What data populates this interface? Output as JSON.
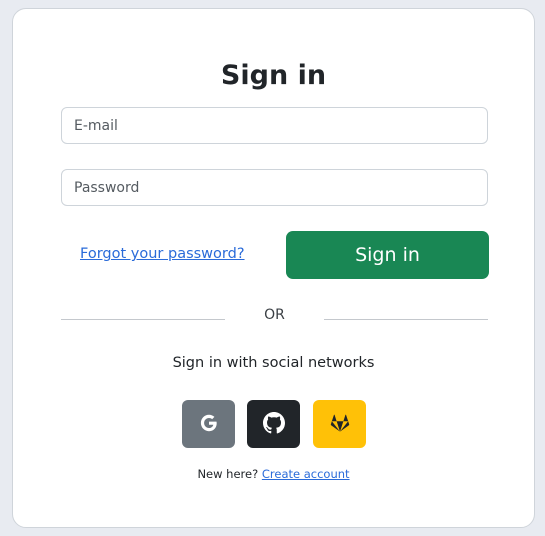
{
  "title": "Sign in",
  "form": {
    "email_placeholder": "E-mail",
    "password_placeholder": "Password",
    "forgot_label": "Forgot your password?",
    "signin_label": "Sign in"
  },
  "divider": {
    "or_label": "OR"
  },
  "social": {
    "heading": "Sign in with social networks",
    "buttons": [
      {
        "name": "google",
        "icon": "google-icon",
        "color": "#6c757d"
      },
      {
        "name": "github",
        "icon": "github-icon",
        "color": "#212529"
      },
      {
        "name": "gitlab",
        "icon": "gitlab-icon",
        "color": "#ffc107"
      }
    ]
  },
  "footer": {
    "prompt": "New here?",
    "link_label": "Create account"
  },
  "colors": {
    "primary": "#198754",
    "link": "#2a6bd9",
    "background": "#e8ebf1"
  }
}
